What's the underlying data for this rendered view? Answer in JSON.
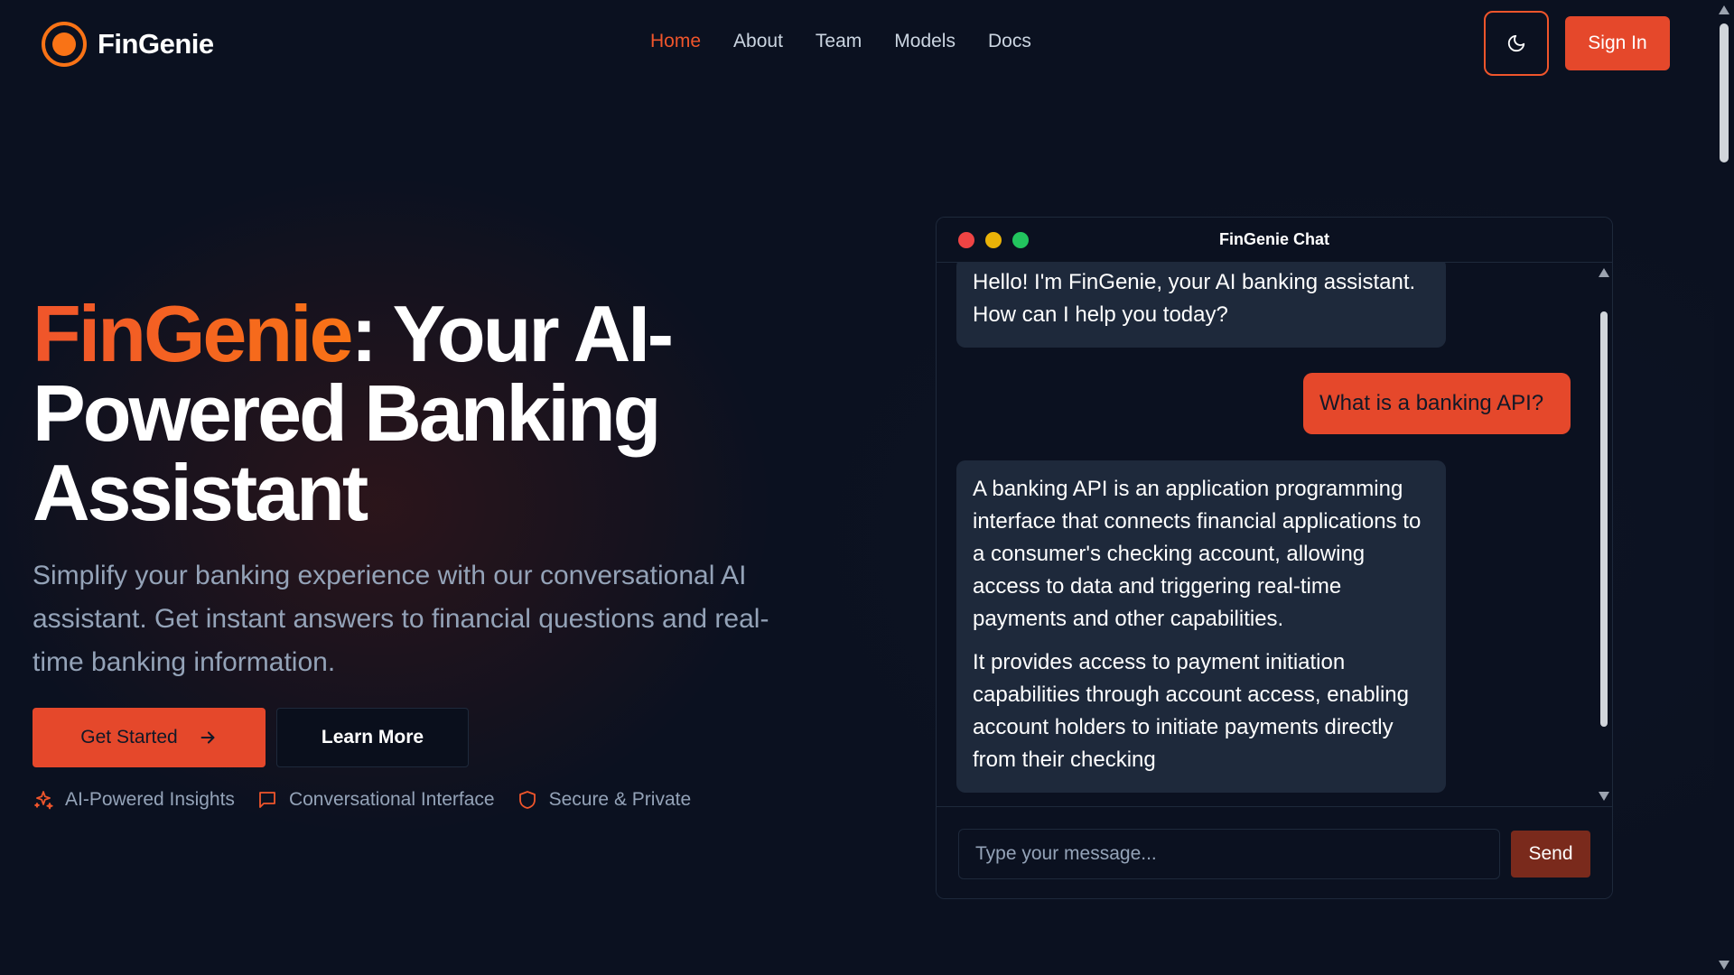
{
  "nav": {
    "logo_text": "FinGenie",
    "items": [
      {
        "label": "Home",
        "active": true
      },
      {
        "label": "About",
        "active": false
      },
      {
        "label": "Team",
        "active": false
      },
      {
        "label": "Models",
        "active": false
      },
      {
        "label": "Docs",
        "active": false
      }
    ],
    "theme_icon": "moon-icon",
    "sign_in_label": "Sign In"
  },
  "hero": {
    "title_brand": "FinGenie",
    "title_rest": ": Your AI-Powered Banking Assistant",
    "subtitle": "Simplify your banking experience with our conversational AI assistant. Get instant answers to financial questions and real-time banking information.",
    "primary_button": "Get Started",
    "primary_button_icon": "arrow-right-icon",
    "secondary_button": "Learn More",
    "features": [
      {
        "icon": "sparkles-icon",
        "label": "AI-Powered Insights"
      },
      {
        "icon": "message-square-icon",
        "label": "Conversational Interface"
      },
      {
        "icon": "shield-icon",
        "label": "Secure & Private"
      }
    ]
  },
  "chat": {
    "title": "FinGenie Chat",
    "messages": [
      {
        "role": "assistant",
        "text": "Hello! I'm FinGenie, your AI banking assistant. How can I help you today?"
      },
      {
        "role": "user",
        "text": "What is a banking API?"
      },
      {
        "role": "assistant",
        "paragraphs": [
          "A banking API is an application programming interface that connects financial applications to a consumer's checking account, allowing access to data and triggering real-time payments and other capabilities.",
          "It provides access to payment initiation capabilities through account access, enabling account holders to initiate payments directly from their checking"
        ]
      }
    ],
    "input_placeholder": "Type your message...",
    "send_label": "Send"
  },
  "colors": {
    "accent": "#e5482b",
    "brand_orange": "#f97316",
    "background": "#0b1120",
    "bubble": "#1e293b",
    "traffic_red": "#ef4444",
    "traffic_yellow": "#eab308",
    "traffic_green": "#22c55e"
  }
}
